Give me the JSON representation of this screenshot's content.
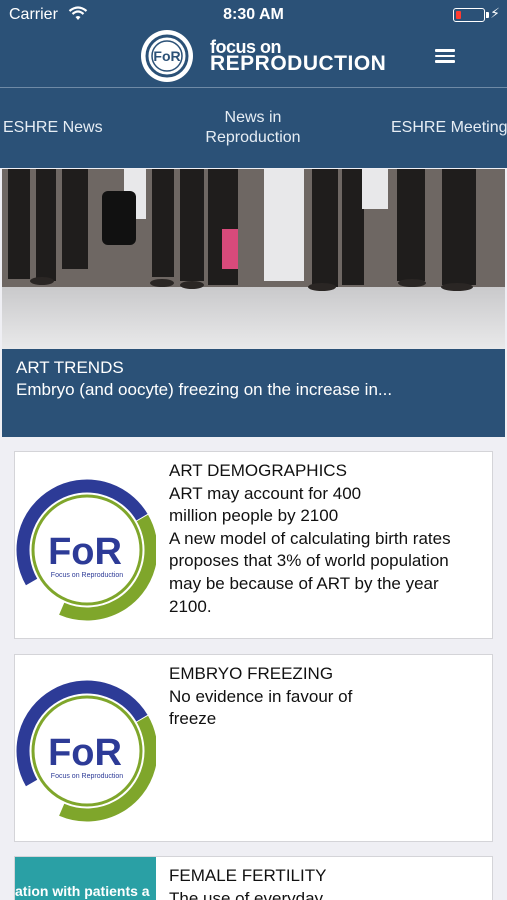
{
  "status_bar": {
    "carrier": "Carrier",
    "time": "8:30 AM"
  },
  "header": {
    "logo_badge_text": "FoR",
    "logo_line1": "focus on",
    "logo_line2": "REPRODUCTION",
    "menu_icon": "hamburger-menu-icon"
  },
  "tabs": [
    {
      "label": "ESHRE News"
    },
    {
      "label": "News in\nReproduction"
    },
    {
      "label": "ESHRE Meetings"
    }
  ],
  "featured": {
    "kicker": "ART TRENDS",
    "headline": "Embryo (and oocyte) freezing on the increase in..."
  },
  "articles": [
    {
      "kicker": "ART DEMOGRAPHICS",
      "title": "ART may account for 400 million people by 2100",
      "summary": "A new model of calculating birth rates proposes that 3% of world population may be because of ART by the year 2100.",
      "thumb_label": "FoR",
      "thumb_sub": "Focus on Reproduction"
    },
    {
      "kicker": "EMBRYO FREEZING",
      "title": "No evidence in favour of freeze",
      "summary": "",
      "thumb_label": "FoR",
      "thumb_sub": "Focus on Reproduction"
    },
    {
      "kicker": "FEMALE FERTILITY",
      "title": "The use of everyday",
      "thumb_text": "ation with patients a"
    }
  ],
  "colors": {
    "brand_navy": "#2b5177",
    "logo_blue": "#2d3b97",
    "logo_green": "#7fa62b",
    "teal": "#2aa0a5"
  }
}
